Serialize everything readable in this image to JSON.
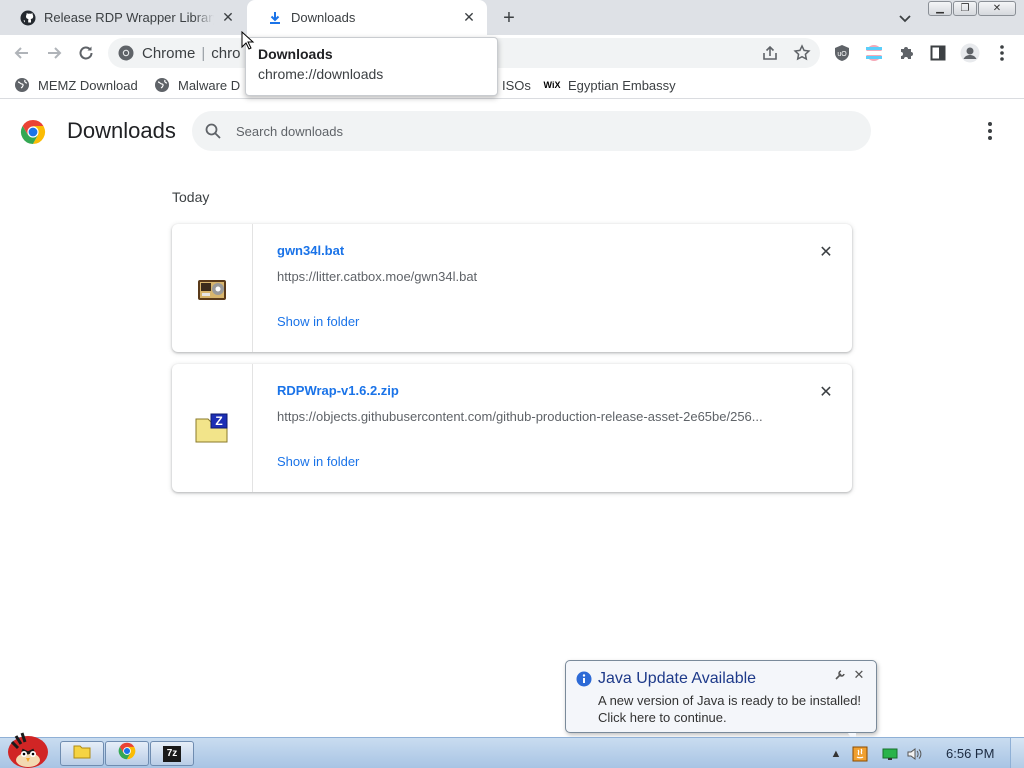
{
  "browser": {
    "tabs": [
      {
        "title": "Release RDP Wrapper Library",
        "icon": "github-icon"
      },
      {
        "title": "Downloads",
        "icon": "download-icon"
      }
    ],
    "omnibox": {
      "site_label": "Chrome",
      "url_fragment": "chro"
    },
    "bookmarks": [
      {
        "label": "MEMZ Download",
        "icon": "globe-icon"
      },
      {
        "label": "Malware D",
        "icon": "globe-icon"
      },
      {
        "label": "ISOs",
        "icon": "globe-icon"
      },
      {
        "label": "Egyptian Embassy",
        "icon": "wix-icon",
        "icon_text": "WiX"
      }
    ],
    "tooltip": {
      "title": "Downloads",
      "url": "chrome://downloads"
    }
  },
  "downloads": {
    "title": "Downloads",
    "search_placeholder": "Search downloads",
    "section": "Today",
    "items": [
      {
        "filename": "gwn34l.bat",
        "url": "https://litter.catbox.moe/gwn34l.bat",
        "action": "Show in folder",
        "icon": "batch-file-icon"
      },
      {
        "filename": "RDPWrap-v1.6.2.zip",
        "url": "https://objects.githubusercontent.com/github-production-release-asset-2e65be/256...",
        "action": "Show in folder",
        "icon": "zip-file-icon"
      }
    ]
  },
  "notification": {
    "title": "Java Update Available",
    "line1": "A new version of Java is ready to be installed!",
    "line2": "Click here to continue."
  },
  "taskbar": {
    "clock": "6:56 PM",
    "pinned": [
      "explorer-icon",
      "chrome-icon",
      "7zip-icon"
    ],
    "pinned_7zip_label": "7z"
  },
  "colors": {
    "accent": "#1a73e8",
    "tab_strip": "#dee1e6",
    "taskbar": "#b9d0ea"
  }
}
